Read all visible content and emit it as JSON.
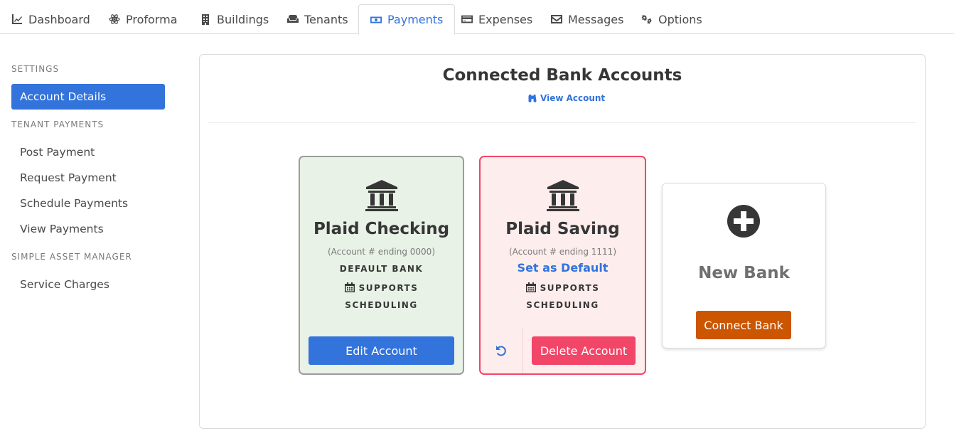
{
  "tabs": [
    {
      "label": "Dashboard",
      "icon": "chart-line-icon"
    },
    {
      "label": "Proforma",
      "icon": "atom-icon"
    },
    {
      "label": "Buildings",
      "icon": "building-icon"
    },
    {
      "label": "Tenants",
      "icon": "couch-icon"
    },
    {
      "label": "Payments",
      "icon": "money-bill-icon",
      "active": true
    },
    {
      "label": "Expenses",
      "icon": "credit-card-icon"
    },
    {
      "label": "Messages",
      "icon": "envelope-icon"
    },
    {
      "label": "Options",
      "icon": "cogs-icon"
    }
  ],
  "sidebar": {
    "settings_label": "SETTINGS",
    "account_details": "Account Details",
    "tenant_payments_label": "TENANT PAYMENTS",
    "post_payment": "Post Payment",
    "request_payment": "Request Payment",
    "schedule_payments": "Schedule Payments",
    "view_payments": "View Payments",
    "simple_asset_label": "SIMPLE ASSET MANAGER",
    "service_charges": "Service Charges"
  },
  "main": {
    "title": "Connected Bank Accounts",
    "view_account": "View Account"
  },
  "banks": [
    {
      "name": "Plaid Checking",
      "account": "(Account # ending 0000)",
      "badge": "DEFAULT BANK",
      "supports": "SUPPORTS",
      "scheduling": "SCHEDULING",
      "action": "Edit Account"
    },
    {
      "name": "Plaid Saving",
      "account": "(Account # ending 1111)",
      "set_default": "Set as Default",
      "supports": "SUPPORTS",
      "scheduling": "SCHEDULING",
      "action": "Delete Account"
    }
  ],
  "new_bank": {
    "label": "New Bank",
    "action": "Connect Bank"
  },
  "colors": {
    "primary": "#3273dc",
    "danger": "#f14668",
    "connect": "#cc5500",
    "default_card_bg": "#e8f2e6",
    "alt_card_bg": "#feeded"
  }
}
